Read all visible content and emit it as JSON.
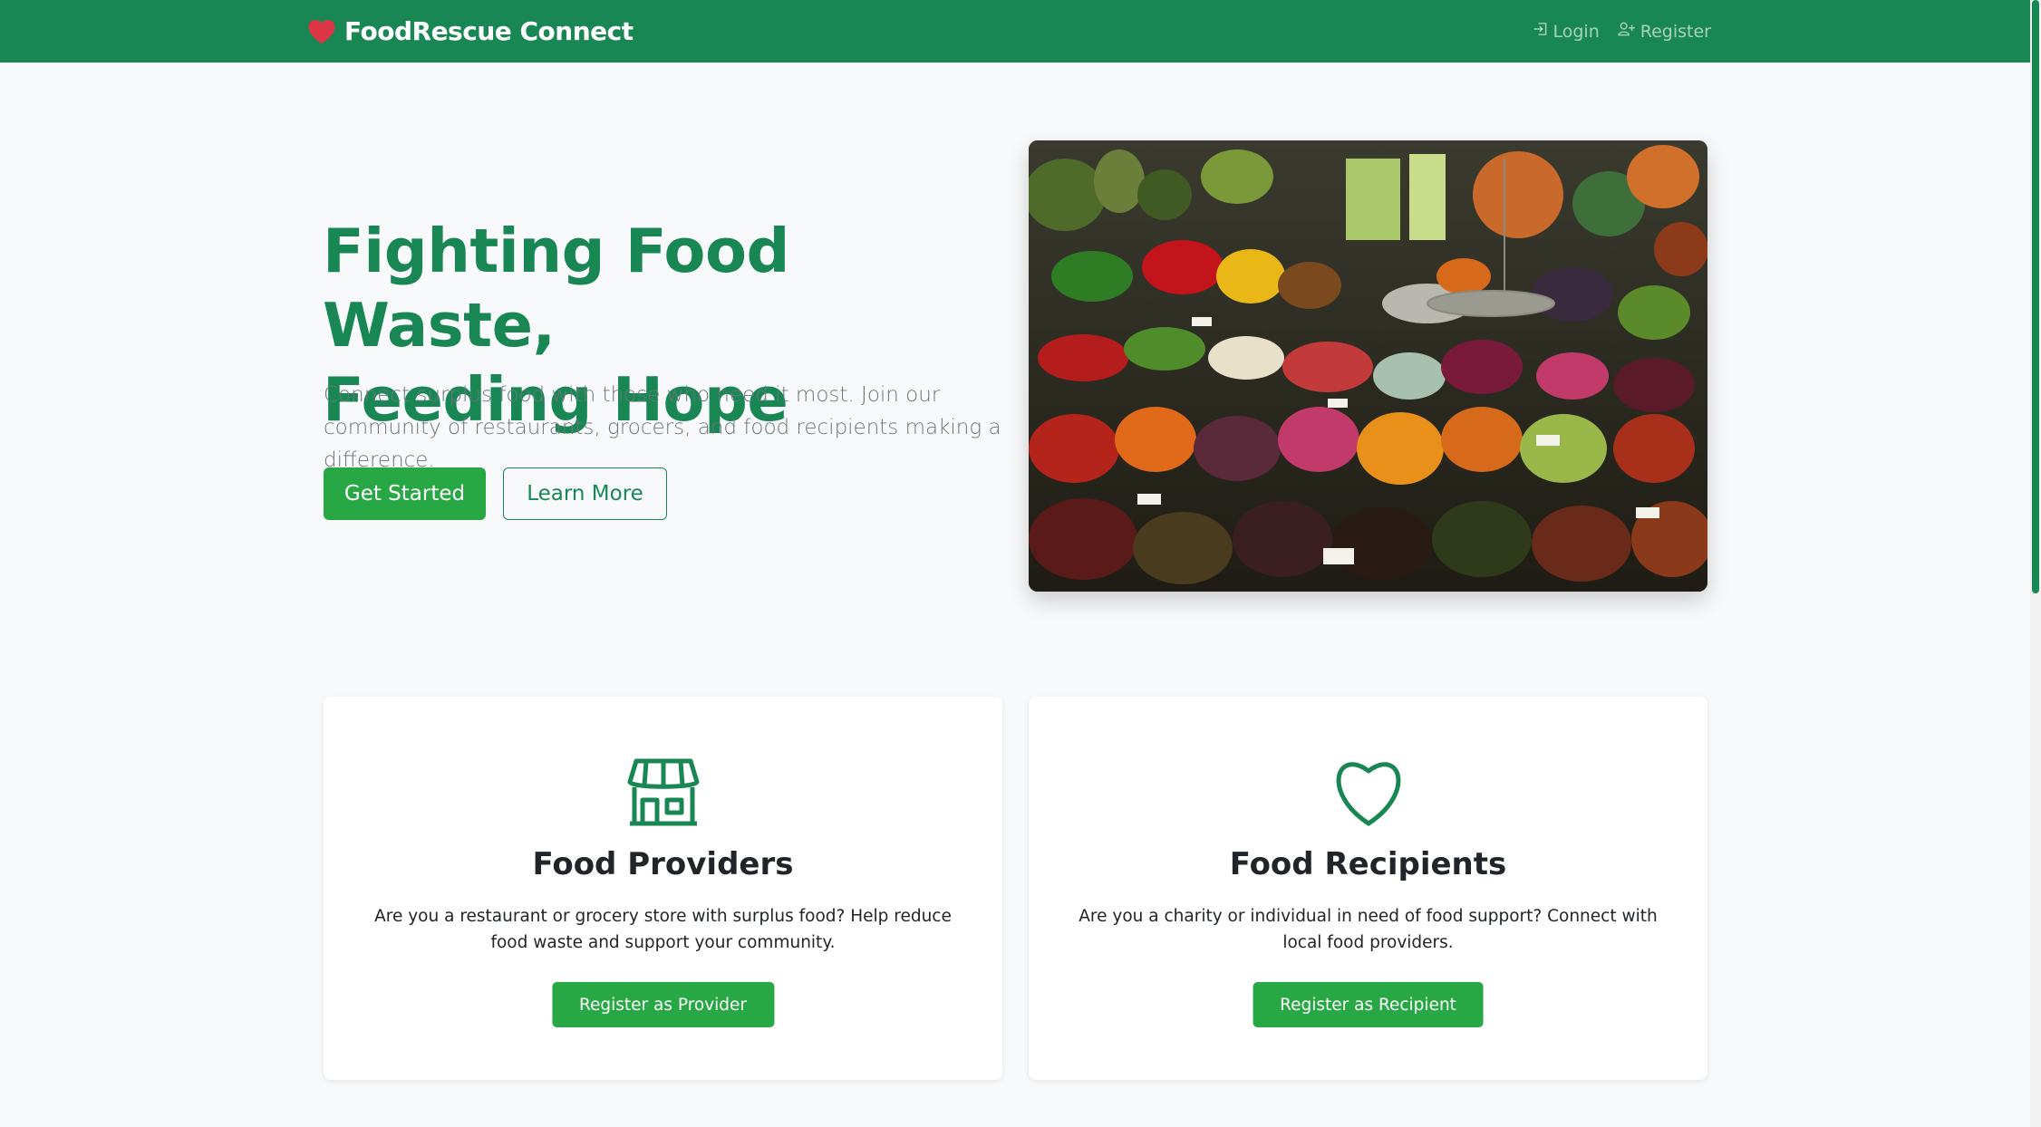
{
  "navbar": {
    "brand": "FoodRescue Connect",
    "login_label": "Login",
    "register_label": "Register",
    "color": "#198754"
  },
  "hero": {
    "title_line1": "Fighting Food Waste,",
    "title_line2": "Feeding Hope",
    "subtitle": "Connect surplus food with those who need it most. Join our community of restaurants, grocers, and food recipients making a difference.",
    "primary_button": "Get Started",
    "secondary_button": "Learn More",
    "image_icon": "produce-market-photo"
  },
  "cards": [
    {
      "icon": "store-icon",
      "title": "Food Providers",
      "text": "Are you a restaurant or grocery store with surplus food? Help reduce food waste and support your community.",
      "button": "Register as Provider"
    },
    {
      "icon": "heart-icon",
      "title": "Food Recipients",
      "text": "Are you a charity or individual in need of food support? Connect with local food providers.",
      "button": "Register as Recipient"
    }
  ],
  "colors": {
    "brand_green": "#198754",
    "button_green": "#28a745",
    "heart_red": "#dc3545"
  }
}
